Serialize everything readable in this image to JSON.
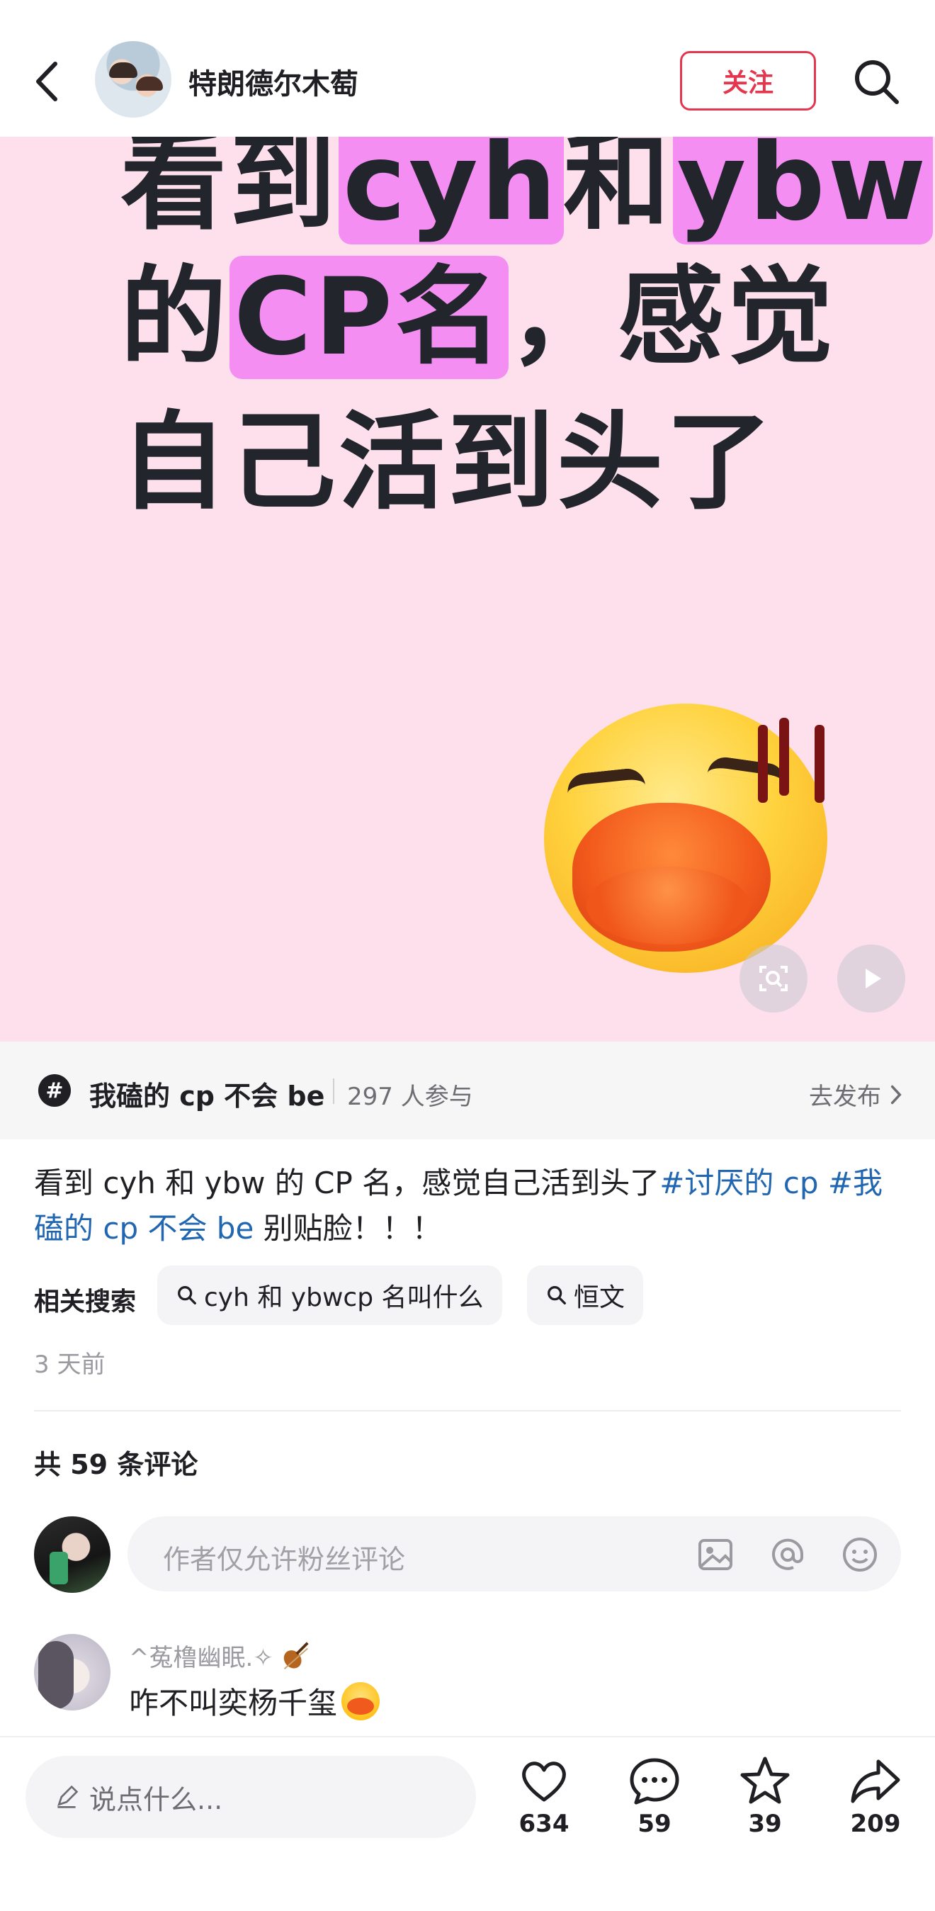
{
  "header": {
    "username": "特朗德尔木萄",
    "follow_label": "关注"
  },
  "post_image": {
    "line1_parts": [
      "看到",
      "cyh",
      "和",
      "ybw"
    ],
    "line2_parts": [
      "的",
      "CP名",
      "，感觉"
    ],
    "line3": "自己活到头了"
  },
  "topic": {
    "icon": "#",
    "name": "我磕的 cp 不会 be",
    "participants": "297 人参与",
    "publish_label": "去发布"
  },
  "description": {
    "text": "看到 cyh 和 ybw 的 CP 名，感觉自己活到头了",
    "tag1": "#讨厌的 cp ",
    "tag2": "#我磕的 cp 不会 be",
    "suffix": " 别贴脸！！！"
  },
  "related": {
    "label": "相关搜索",
    "chips": [
      "cyh 和 ybwcp 名叫什么",
      "恒文"
    ]
  },
  "time": "3 天前",
  "comments": {
    "count_label": "共 59 条评论",
    "input_placeholder": "作者仅允许粉丝评论",
    "items": [
      {
        "name": "^菟橹幽眠.✧",
        "text": "咋不叫奕杨千玺"
      }
    ]
  },
  "bottom": {
    "say_placeholder": "说点什么...",
    "likes": "634",
    "comments": "59",
    "stars": "39",
    "shares": "209"
  }
}
